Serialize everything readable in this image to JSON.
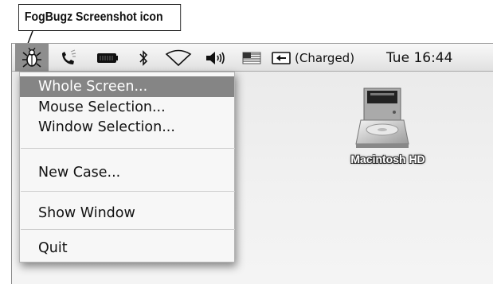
{
  "callout": {
    "label": "FogBugz Screenshot icon"
  },
  "menubar": {
    "status_icons": [
      "fogbugz-bug-icon",
      "phone-icon",
      "battery-icon",
      "bluetooth-icon",
      "airport-wifi-icon",
      "volume-icon",
      "input-menu-flag-icon",
      "power-plug-icon"
    ],
    "battery_status": "(Charged)",
    "clock": "Tue 16:44"
  },
  "menu": {
    "items": [
      {
        "label": "Whole Screen...",
        "highlighted": true
      },
      {
        "label": "Mouse Selection..."
      },
      {
        "label": "Window Selection..."
      },
      {
        "label": "New Case..."
      },
      {
        "label": "Show Window"
      },
      {
        "label": "Quit"
      }
    ]
  },
  "desktop": {
    "icons": [
      {
        "label": "Macintosh HD",
        "icon": "hard-drive-icon"
      }
    ]
  },
  "colors": {
    "highlight": "#858585",
    "menubar_selected": "#8e8e8e"
  }
}
